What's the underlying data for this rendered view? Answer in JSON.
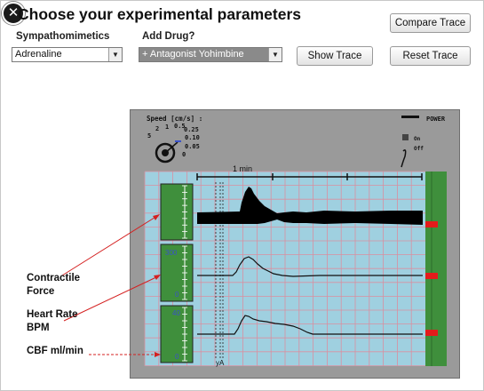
{
  "title": "Choose your experimental parameters",
  "controls": {
    "sympathomimetics_label": "Sympathomimetics",
    "sympathomimetics_value": "Adrenaline",
    "add_drug_label": "Add Drug?",
    "add_drug_value": "+ Antagonist Yohimbine",
    "compare_trace_label": "Compare Trace",
    "show_trace_label": "Show Trace",
    "reset_trace_label": "Reset Trace"
  },
  "device": {
    "speed_label": "Speed [cm/s] :",
    "speed_values": [
      "2",
      "1",
      "0.5",
      "0.25",
      "5",
      "0.10",
      "0.05",
      "0"
    ],
    "power_label": "POWER",
    "on_label": "On",
    "off_label": "Off",
    "time_scale_label": "1 min",
    "gauge1_top": "300",
    "gauge1_bottom": "0",
    "gauge2_top": "40",
    "gauge2_bottom": "0",
    "marker_label": "yA"
  },
  "annotations": {
    "contractile": [
      "Contractile",
      "Force"
    ],
    "heart_rate": [
      "Heart Rate",
      "BPM"
    ],
    "cbf": "CBF ml/min"
  },
  "colors": {
    "chart_bg": "#9fd0e0",
    "grid": "#d98fa0",
    "gauge_green": "#3f8f3c",
    "red_marker": "#e41b1b",
    "arrow_red": "#d42020"
  }
}
